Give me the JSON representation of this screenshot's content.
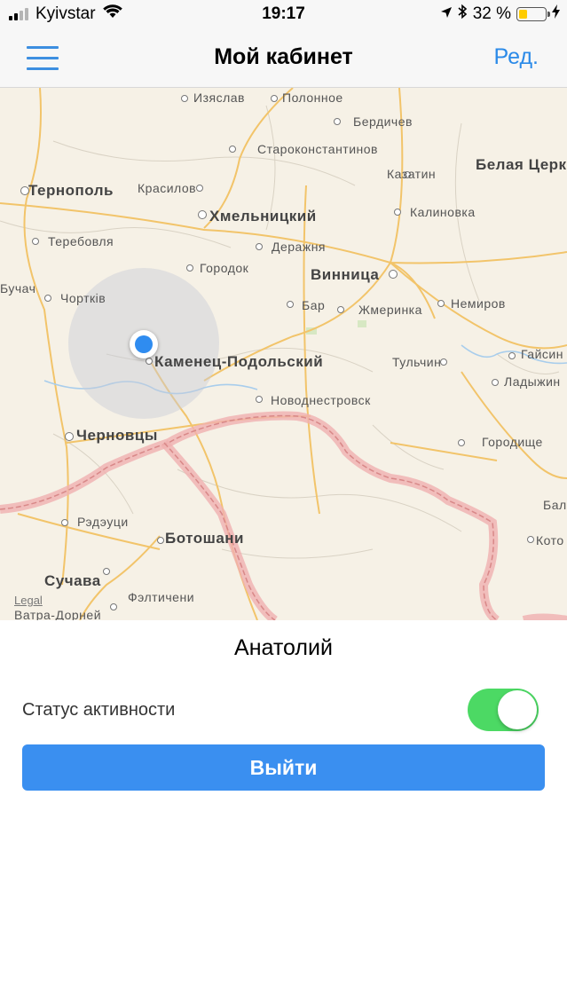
{
  "status_bar": {
    "carrier": "Kyivstar",
    "time": "19:17",
    "battery_percent": "32 %",
    "battery_level": 0.32,
    "signal_bars_active": 2,
    "signal_bars_total": 4,
    "icons": [
      "wifi-icon",
      "location-arrow-icon",
      "bluetooth-icon",
      "battery-icon",
      "charging-bolt-icon"
    ]
  },
  "navbar": {
    "title": "Мой кабинет",
    "edit_label": "Ред.",
    "menu_icon": "hamburger-menu-icon",
    "accent_color": "#2b8ae8"
  },
  "map": {
    "legal_label": "Legal",
    "cities": [
      {
        "name": "Изяслав"
      },
      {
        "name": "Полонное"
      },
      {
        "name": "Бердичев"
      },
      {
        "name": "Староконстантинов"
      },
      {
        "name": "Тернополь",
        "major": true
      },
      {
        "name": "Красилов"
      },
      {
        "name": "Казатин"
      },
      {
        "name": "Белая Церк",
        "major": true
      },
      {
        "name": "Хмельницкий",
        "major": true
      },
      {
        "name": "Калиновка"
      },
      {
        "name": "Теребовля"
      },
      {
        "name": "Деражня"
      },
      {
        "name": "Городок"
      },
      {
        "name": "Винница",
        "major": true
      },
      {
        "name": "Бучач"
      },
      {
        "name": "Чортків"
      },
      {
        "name": "Бар"
      },
      {
        "name": "Жмеринка"
      },
      {
        "name": "Немиров"
      },
      {
        "name": "Гайсин"
      },
      {
        "name": "Каменец-Подольский",
        "major": true
      },
      {
        "name": "Тульчин"
      },
      {
        "name": "Ладыжин"
      },
      {
        "name": "Новоднестровск"
      },
      {
        "name": "Черновцы",
        "major": true
      },
      {
        "name": "Городище"
      },
      {
        "name": "Рэдэуци"
      },
      {
        "name": "Ботошани",
        "major": true
      },
      {
        "name": "Бал"
      },
      {
        "name": "Кото"
      },
      {
        "name": "Сучава",
        "major": true
      },
      {
        "name": "Фэлтичени"
      },
      {
        "name": "Ватра-Дорней"
      }
    ],
    "user_location_color": "#2f8cf0",
    "border_color": "#e89b9b"
  },
  "profile": {
    "user_name": "Анатолий",
    "status_label": "Статус активности",
    "status_active": true,
    "toggle_color": "#4cd964"
  },
  "logout_label": "Выйти",
  "logout_color": "#3a8ff0"
}
